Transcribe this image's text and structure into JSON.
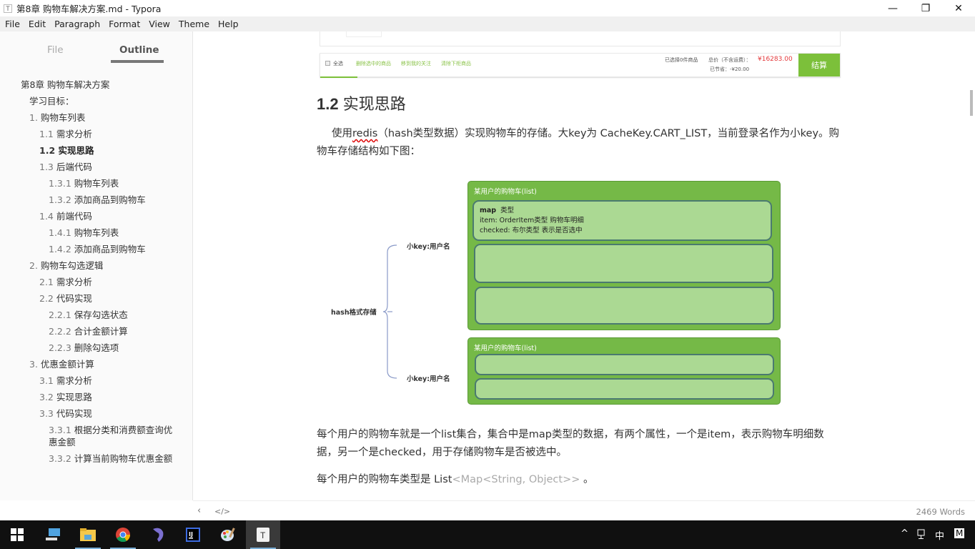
{
  "window": {
    "title": "第8章 购物车解决方案.md - Typora",
    "app_icon": "T",
    "controls": {
      "minimize": "—",
      "restore": "❐",
      "close": "✕"
    }
  },
  "menu": [
    "File",
    "Edit",
    "Paragraph",
    "Format",
    "View",
    "Theme",
    "Help"
  ],
  "sidebar": {
    "tabs": [
      {
        "label": "File",
        "active": false
      },
      {
        "label": "Outline",
        "active": true
      }
    ],
    "outline": [
      {
        "num": "",
        "text": "第8章 购物车解决方案",
        "level": 0,
        "active": false
      },
      {
        "num": "",
        "text": "学习目标：",
        "level": 1,
        "active": false
      },
      {
        "num": "1.",
        "text": "购物车列表",
        "level": 1,
        "active": false
      },
      {
        "num": "1.1",
        "text": "需求分析",
        "level": 2,
        "active": false
      },
      {
        "num": "1.2",
        "text": "实现思路",
        "level": 2,
        "active": true
      },
      {
        "num": "1.3",
        "text": "后端代码",
        "level": 2,
        "active": false
      },
      {
        "num": "1.3.1",
        "text": "购物车列表",
        "level": 3,
        "active": false
      },
      {
        "num": "1.3.2",
        "text": "添加商品到购物车",
        "level": 3,
        "active": false
      },
      {
        "num": "1.4",
        "text": "前端代码",
        "level": 2,
        "active": false
      },
      {
        "num": "1.4.1",
        "text": "购物车列表",
        "level": 3,
        "active": false
      },
      {
        "num": "1.4.2",
        "text": "添加商品到购物车",
        "level": 3,
        "active": false
      },
      {
        "num": "2.",
        "text": "购物车勾选逻辑",
        "level": 1,
        "active": false
      },
      {
        "num": "2.1",
        "text": "需求分析",
        "level": 2,
        "active": false
      },
      {
        "num": "2.2",
        "text": "代码实现",
        "level": 2,
        "active": false
      },
      {
        "num": "2.2.1",
        "text": "保存勾选状态",
        "level": 3,
        "active": false
      },
      {
        "num": "2.2.2",
        "text": "合计金额计算",
        "level": 3,
        "active": false
      },
      {
        "num": "2.2.3",
        "text": "删除勾选项",
        "level": 3,
        "active": false
      },
      {
        "num": "3.",
        "text": "优惠金额计算",
        "level": 1,
        "active": false
      },
      {
        "num": "3.1",
        "text": "需求分析",
        "level": 2,
        "active": false
      },
      {
        "num": "3.2",
        "text": "实现思路",
        "level": 2,
        "active": false
      },
      {
        "num": "3.3",
        "text": "代码实现",
        "level": 2,
        "active": false
      },
      {
        "num": "3.3.1",
        "text": "根据分类和消费额查询优",
        "text2": "惠金额",
        "level": 3,
        "active": false
      },
      {
        "num": "3.3.2",
        "text": "计算当前购物车优惠金额",
        "level": 3,
        "active": false
      }
    ]
  },
  "cart_image": {
    "select_all": "全选",
    "links": [
      "删除选中的商品",
      "移到我的关注",
      "清除下柜商品"
    ],
    "selected_count": "已选择0件商品",
    "total_label": "总价（不含运费）：",
    "total_price": "¥16283.00",
    "saved": "已节省：-¥20.00",
    "checkout": "结算"
  },
  "doc": {
    "heading_num": "1.2",
    "heading_text": "实现思路",
    "p1_before": "使用",
    "p1_redis": "redis",
    "p1_after": "（hash类型数据）实现购物车的存储。大key为  CacheKey.CART_LIST，当前登录名作为小key。购物车存储结构如下图：",
    "p2": "每个用户的购物车就是一个list集合，集合中是map类型的数据，有两个属性，一个是item，表示购物车明细数据，另一个是checked，用于存储购物车是否被选中。",
    "p3_before": "每个用户的购物车类型是 List",
    "p3_gray": "<Map<String, Object>>",
    "p3_after": " 。"
  },
  "diagram": {
    "root": "hash格式存储",
    "small_key_1": "小key:用户名",
    "small_key_2": "小key:用户名",
    "list_label_1": "某用户的购物车(list)",
    "list_label_2": "某用户的购物车(list)",
    "map_title": "map",
    "map_title_suffix": "类型",
    "map_line1": "item:  OrderItem类型   购物车明细",
    "map_line2": "checked:  布尔类型  表示是否选中"
  },
  "statusbar": {
    "back_icon": "‹",
    "source_icon": "</>",
    "word_count": "2469 Words"
  },
  "taskbar": {
    "apps": [
      "windows-start",
      "this-pc",
      "file-explorer",
      "chrome",
      "dolphin-app",
      "intellij-idea",
      "paint",
      "typora"
    ],
    "tray": {
      "chevron": "^",
      "ime": "中",
      "ime_mode": "M"
    }
  },
  "colors": {
    "accent_green": "#75b947",
    "map_green": "#abd993",
    "price_red": "#e4393c",
    "taskbar_bg": "#101010"
  }
}
